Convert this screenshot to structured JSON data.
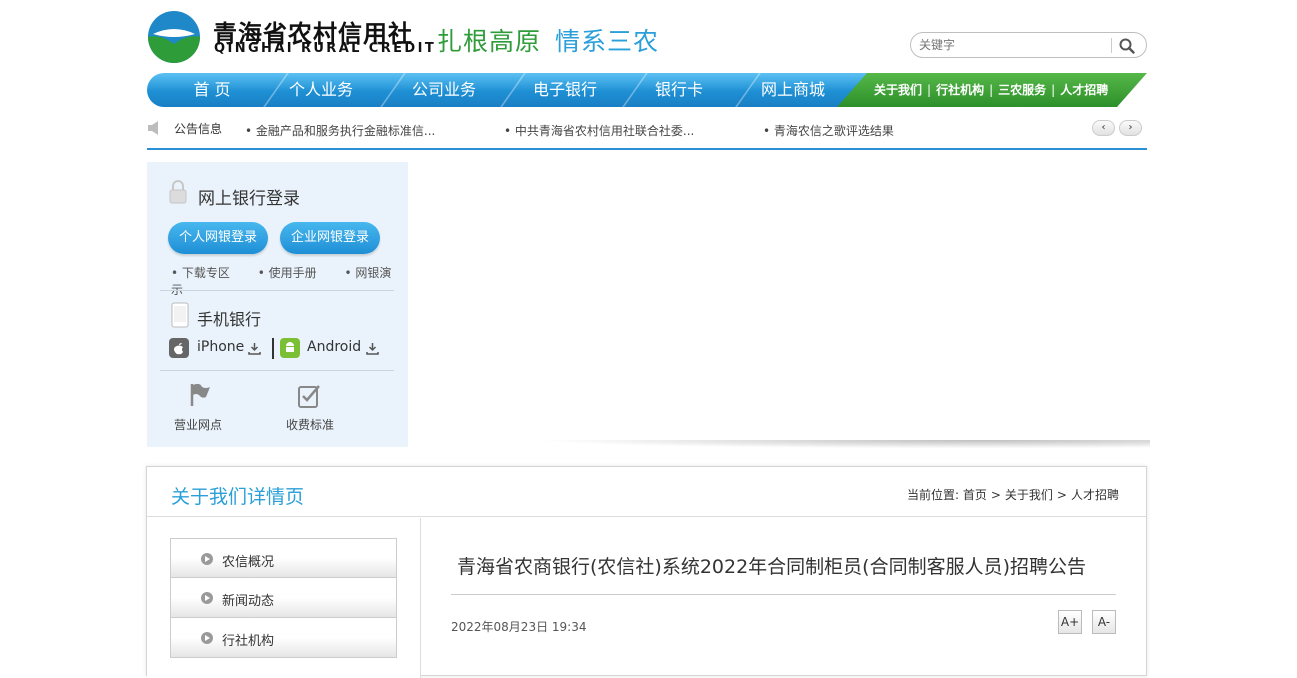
{
  "header": {
    "logo_cn": "青海省农村信用社",
    "logo_en": "QINGHAI RURAL CREDIT",
    "slogan_a": "扎根高原",
    "slogan_b": "情系三农",
    "search_placeholder": "关键字",
    "search_icon": "search-icon"
  },
  "nav": {
    "items": [
      "首 页",
      "个人业务",
      "公司业务",
      "电子银行",
      "银行卡",
      "网上商城"
    ],
    "right_links": [
      "关于我们",
      "行社机构",
      "三农服务",
      "人才招聘"
    ],
    "separator": "|"
  },
  "notice": {
    "label": "公告信息",
    "items": [
      "金融产品和服务执行金融标准信...",
      "中共青海省农村信用社联合社委...",
      "青海农信之歌评选结果"
    ],
    "prev": "‹",
    "next": "›"
  },
  "login": {
    "title": "网上银行登录",
    "personal_btn": "个人网银登录",
    "corporate_btn": "企业网银登录",
    "links": [
      "下载专区",
      "使用手册",
      "网银演示"
    ],
    "mobile_title": "手机银行",
    "iphone": "iPhone",
    "android": "Android",
    "branches": "营业网点",
    "fees": "收费标准"
  },
  "detail": {
    "title": "关于我们详情页",
    "crumb_prefix": "当前位置:",
    "crumb": [
      "首页",
      "关于我们",
      "人才招聘"
    ],
    "crumb_sep": ">",
    "side_items": [
      "农信概况",
      "新闻动态",
      "行社机构"
    ],
    "article_title": "青海省农商银行(农信社)系统2022年合同制柜员(合同制客服人员)招聘公告",
    "article_date": "2022年08月23日 19:34",
    "font_up": "A+",
    "font_down": "A-"
  },
  "colors": {
    "blue": "#2a9fd8",
    "green": "#2f9c3a"
  }
}
